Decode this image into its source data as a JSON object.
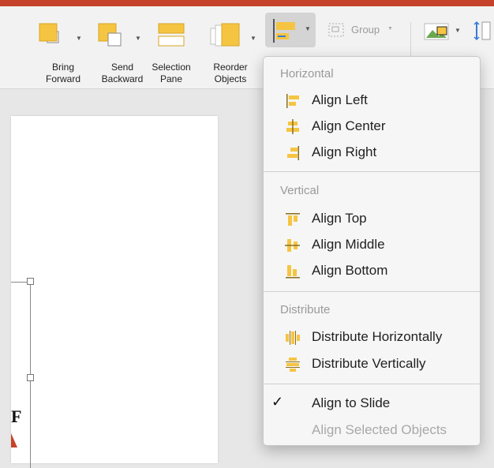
{
  "ribbon": {
    "bring_forward": [
      "Bring",
      "Forward"
    ],
    "send_backward": [
      "Send",
      "Backward"
    ],
    "selection_pane": [
      "Selection",
      "Pane"
    ],
    "reorder_objects": [
      "Reorder",
      "Objects"
    ],
    "group_label": "Group"
  },
  "menu": {
    "horizontal_header": "Horizontal",
    "align_left": "Align Left",
    "align_center": "Align Center",
    "align_right": "Align Right",
    "vertical_header": "Vertical",
    "align_top": "Align Top",
    "align_middle": "Align Middle",
    "align_bottom": "Align Bottom",
    "distribute_header": "Distribute",
    "distribute_horizontally": "Distribute Horizontally",
    "distribute_vertically": "Distribute Vertically",
    "align_to_slide": "Align to Slide",
    "align_selected_objects": "Align Selected Objects",
    "check_mark": "✓"
  },
  "slide": {
    "partial_letter": "F"
  },
  "colors": {
    "accent": "#c5432a",
    "icon_yellow": "#f5c542",
    "icon_blue": "#3a7bd5"
  },
  "icons": [
    "bring-forward-icon",
    "send-backward-icon",
    "selection-pane-icon",
    "reorder-objects-icon",
    "align-icon",
    "group-icon",
    "picture-icon",
    "height-icon"
  ]
}
